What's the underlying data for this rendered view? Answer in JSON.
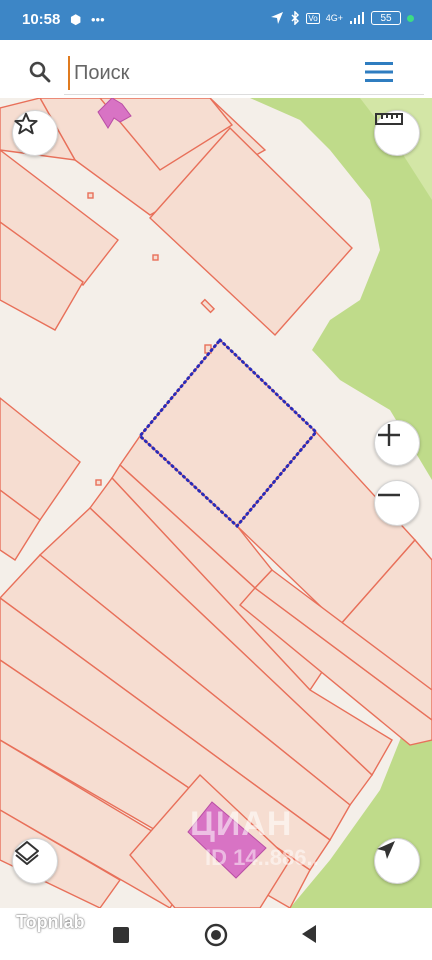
{
  "status_bar": {
    "time": "10:58",
    "left_icons": [
      "hexagon-icon",
      "more-dots-icon"
    ],
    "right_icons": [
      "location-arrow-icon",
      "bluetooth-icon",
      "volte-icon",
      "4g-signal-icon",
      "battery-icon",
      "green-dot-icon"
    ],
    "network": "4G+",
    "battery": "55"
  },
  "search": {
    "placeholder": "Поиск"
  },
  "map": {
    "watermark": "ЦИАН",
    "watermark_sub": "ID 14..886..",
    "colors": {
      "background": "#f4efe9",
      "parcel_fill": "#f6ddd1",
      "parcel_stroke": "#e8705a",
      "green_area": "#bfdb8a",
      "building": "#d873c4",
      "selection": "#2b2bb8"
    }
  },
  "controls": {
    "favorite": "star-icon",
    "ruler": "ruler-icon",
    "zoom_in": "plus-icon",
    "zoom_out": "minus-icon",
    "layers": "layers-icon",
    "locate": "navigation-arrow-icon"
  },
  "footer": {
    "watermark_text": "Topnlab"
  },
  "nav_bar": {
    "buttons": [
      "recents-square-icon",
      "home-circle-icon",
      "back-triangle-icon"
    ]
  }
}
